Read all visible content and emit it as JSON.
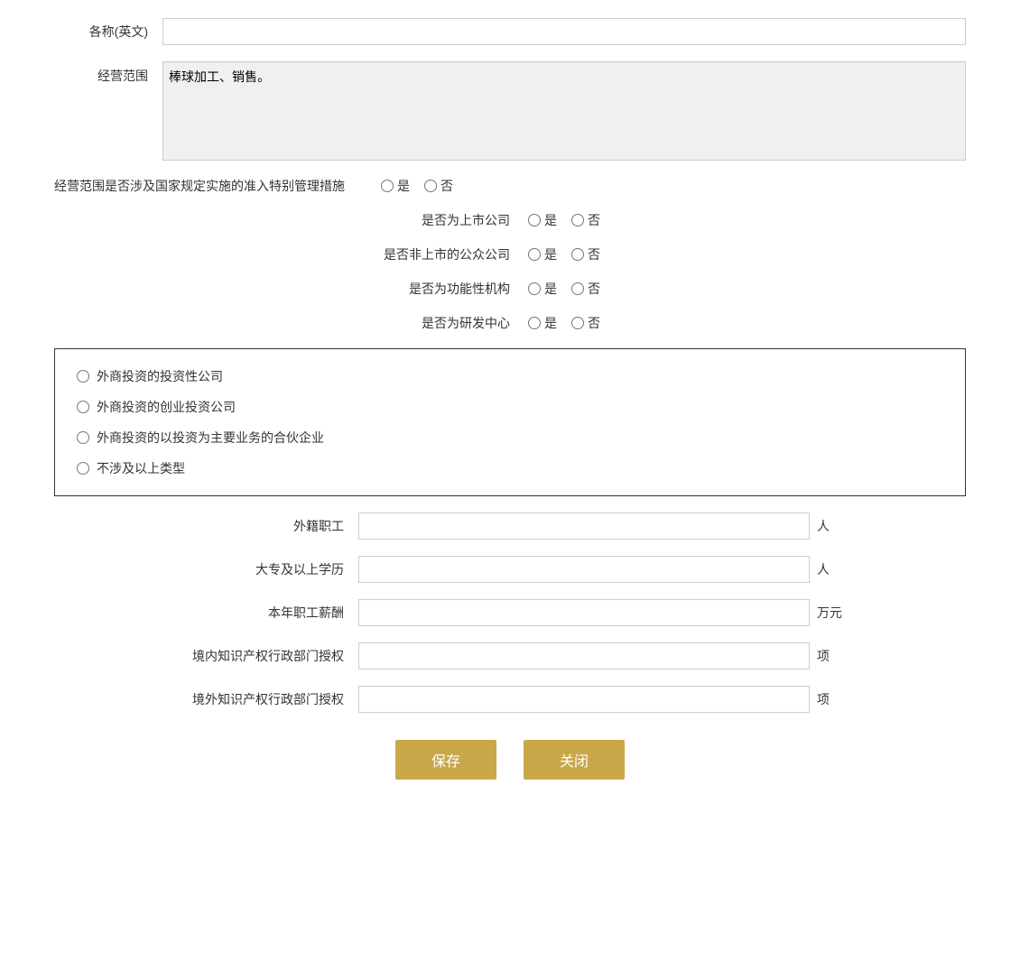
{
  "form": {
    "name_en_label": "各称(英文)",
    "name_en_value": "",
    "jyfw_label": "经营范围",
    "jyfw_value": "棒球加工、销售。",
    "jyfw_special_label": "经营范围是否涉及国家规定实施的准入特别管理措施",
    "radio_yes": "是",
    "radio_no": "否",
    "listed_label": "是否为上市公司",
    "non_listed_public_label": "是否非上市的公众公司",
    "functional_label": "是否为功能性机构",
    "rd_center_label": "是否为研发中心",
    "box_options": [
      "外商投资的投资性公司",
      "外商投资的创业投资公司",
      "外商投资的以投资为主要业务的合伙企业",
      "不涉及以上类型"
    ],
    "foreign_workers_label": "外籍职工",
    "foreign_workers_unit": "人",
    "college_edu_label": "大专及以上学历",
    "college_edu_unit": "人",
    "salary_label": "本年职工薪酬",
    "salary_unit": "万元",
    "domestic_ip_label": "境内知识产权行政部门授权",
    "domestic_ip_unit": "项",
    "foreign_ip_label": "境外知识产权行政部门授权",
    "foreign_ip_unit": "项",
    "save_btn": "保存",
    "close_btn": "关闭"
  }
}
